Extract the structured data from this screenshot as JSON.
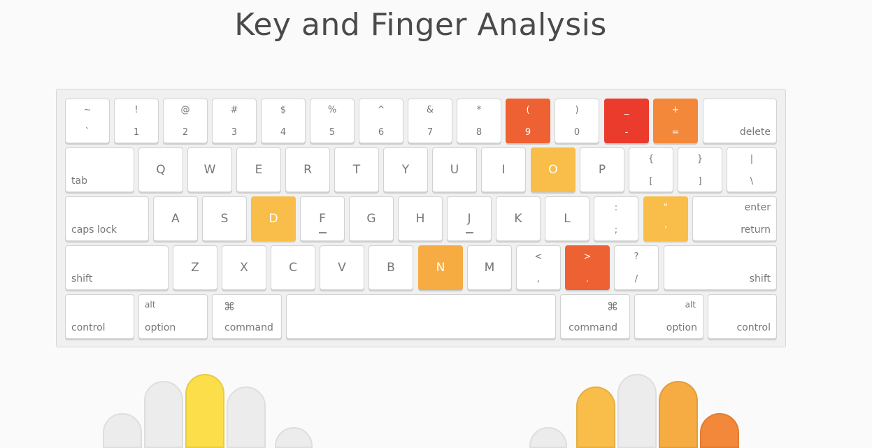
{
  "title": "Key and Finger Analysis",
  "colors": {
    "red": "#ea3b2d",
    "red_orange": "#ee6133",
    "orange": "#f3873a",
    "light_orange": "#f6ac43",
    "yellow_orange": "#f8be49",
    "yellow": "#fbde4a",
    "neutral": "#ececec"
  },
  "keyboard": {
    "row1": [
      {
        "top": "~",
        "bottom": "`"
      },
      {
        "top": "!",
        "bottom": "1"
      },
      {
        "top": "@",
        "bottom": "2"
      },
      {
        "top": "#",
        "bottom": "3"
      },
      {
        "top": "$",
        "bottom": "4"
      },
      {
        "top": "%",
        "bottom": "5"
      },
      {
        "top": "^",
        "bottom": "6"
      },
      {
        "top": "&",
        "bottom": "7"
      },
      {
        "top": "*",
        "bottom": "8"
      },
      {
        "top": "(",
        "bottom": "9"
      },
      {
        "top": ")",
        "bottom": "0"
      },
      {
        "top": "_",
        "bottom": "-"
      },
      {
        "top": "+",
        "bottom": "="
      },
      {
        "label": "delete"
      }
    ],
    "row2": [
      {
        "label": "tab"
      },
      {
        "char": "Q"
      },
      {
        "char": "W"
      },
      {
        "char": "E"
      },
      {
        "char": "R"
      },
      {
        "char": "T"
      },
      {
        "char": "Y"
      },
      {
        "char": "U"
      },
      {
        "char": "I"
      },
      {
        "char": "O"
      },
      {
        "char": "P"
      },
      {
        "top": "{",
        "bottom": "["
      },
      {
        "top": "}",
        "bottom": "]"
      },
      {
        "top": "|",
        "bottom": "\\"
      }
    ],
    "row3": [
      {
        "label": "caps lock"
      },
      {
        "char": "A"
      },
      {
        "char": "S"
      },
      {
        "char": "D"
      },
      {
        "char": "F"
      },
      {
        "char": "G"
      },
      {
        "char": "H"
      },
      {
        "char": "J"
      },
      {
        "char": "K"
      },
      {
        "char": "L"
      },
      {
        "top": ":",
        "bottom": ";"
      },
      {
        "top": "\"",
        "bottom": "'"
      },
      {
        "top_label": "enter",
        "label": "return"
      }
    ],
    "row4": [
      {
        "label": "shift"
      },
      {
        "char": "Z"
      },
      {
        "char": "X"
      },
      {
        "char": "C"
      },
      {
        "char": "V"
      },
      {
        "char": "B"
      },
      {
        "char": "N"
      },
      {
        "char": "M"
      },
      {
        "top": "<",
        "bottom": ","
      },
      {
        "top": ">",
        "bottom": "."
      },
      {
        "top": "?",
        "bottom": "/"
      },
      {
        "label": "shift"
      }
    ],
    "row5": [
      {
        "label": "control"
      },
      {
        "top_label": "alt",
        "label": "option"
      },
      {
        "icon": "⌘",
        "label": "command"
      },
      {
        "label": ""
      },
      {
        "icon": "⌘",
        "label": "command"
      },
      {
        "top_label": "alt",
        "label": "option"
      },
      {
        "label": "control"
      }
    ]
  }
}
